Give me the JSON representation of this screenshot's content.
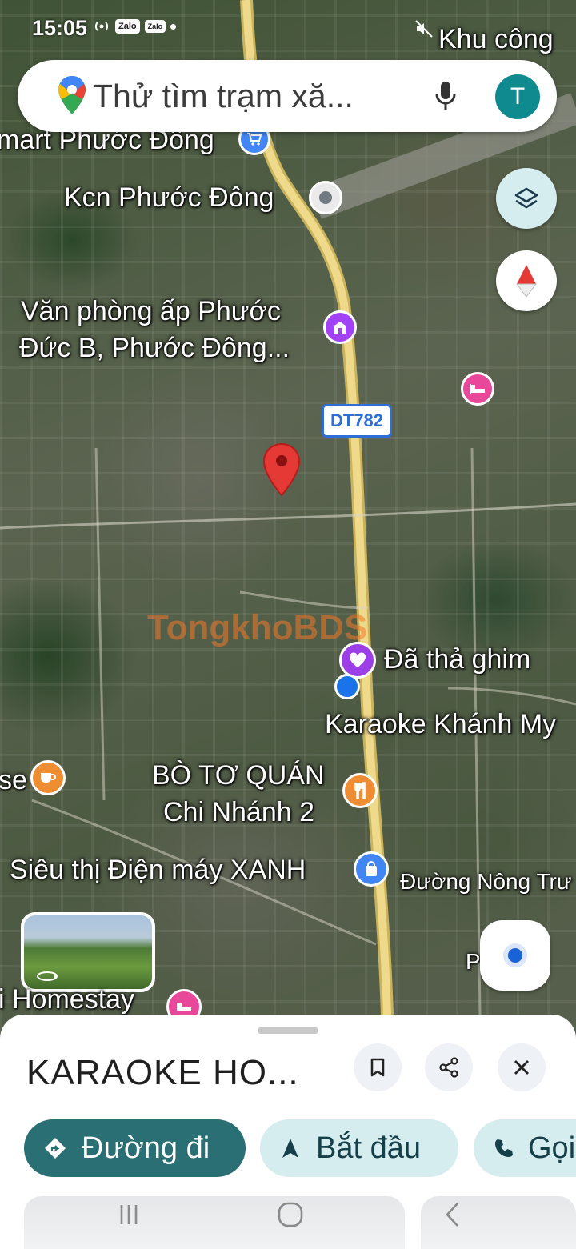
{
  "status_bar": {
    "time": "15:05",
    "chips": [
      "Zalo",
      "Zalo"
    ],
    "corner_label": "Khu công"
  },
  "search": {
    "placeholder": "Thử tìm trạm xă...",
    "avatar_initial": "T"
  },
  "map": {
    "road_shield": "DT782",
    "places": [
      {
        "id": "mart",
        "text": "mart Phước Đông"
      },
      {
        "id": "kcn",
        "text": "Kcn Phước Đông"
      },
      {
        "id": "office_1",
        "text": "Văn phòng ấp Phước"
      },
      {
        "id": "office_2",
        "text": "Đức B, Phước Đông..."
      },
      {
        "id": "pinned",
        "text": "Đã thả ghim"
      },
      {
        "id": "karaoke",
        "text": "Karaoke Khánh My"
      },
      {
        "id": "se",
        "text": "se"
      },
      {
        "id": "bo_to_1",
        "text": "BÒ TƠ QUÁN"
      },
      {
        "id": "bo_to_2",
        "text": "Chi Nhánh 2"
      },
      {
        "id": "dmx",
        "text": "Siêu thị Điện máy XANH"
      },
      {
        "id": "nong_truong",
        "text": "Đường Nông Trư"
      },
      {
        "id": "homestay",
        "text": "i Homestay"
      },
      {
        "id": "p_right",
        "text": "P  Đ"
      }
    ],
    "watermark": "TongkhoBDS",
    "colors": {
      "road": "#e6cf7a",
      "pin_red": "#e53935",
      "accent_teal": "#2a6f73",
      "location_blue": "#1a73e8"
    }
  },
  "sheet": {
    "title": "KARAOKE HO...",
    "buttons": [
      {
        "id": "directions",
        "label": "Đường đi",
        "icon": "diamond-turn-icon"
      },
      {
        "id": "start",
        "label": "Bắt đầu",
        "icon": "navigation-arrow-icon"
      },
      {
        "id": "call",
        "label": "Gọi",
        "icon": "phone-icon"
      }
    ]
  }
}
